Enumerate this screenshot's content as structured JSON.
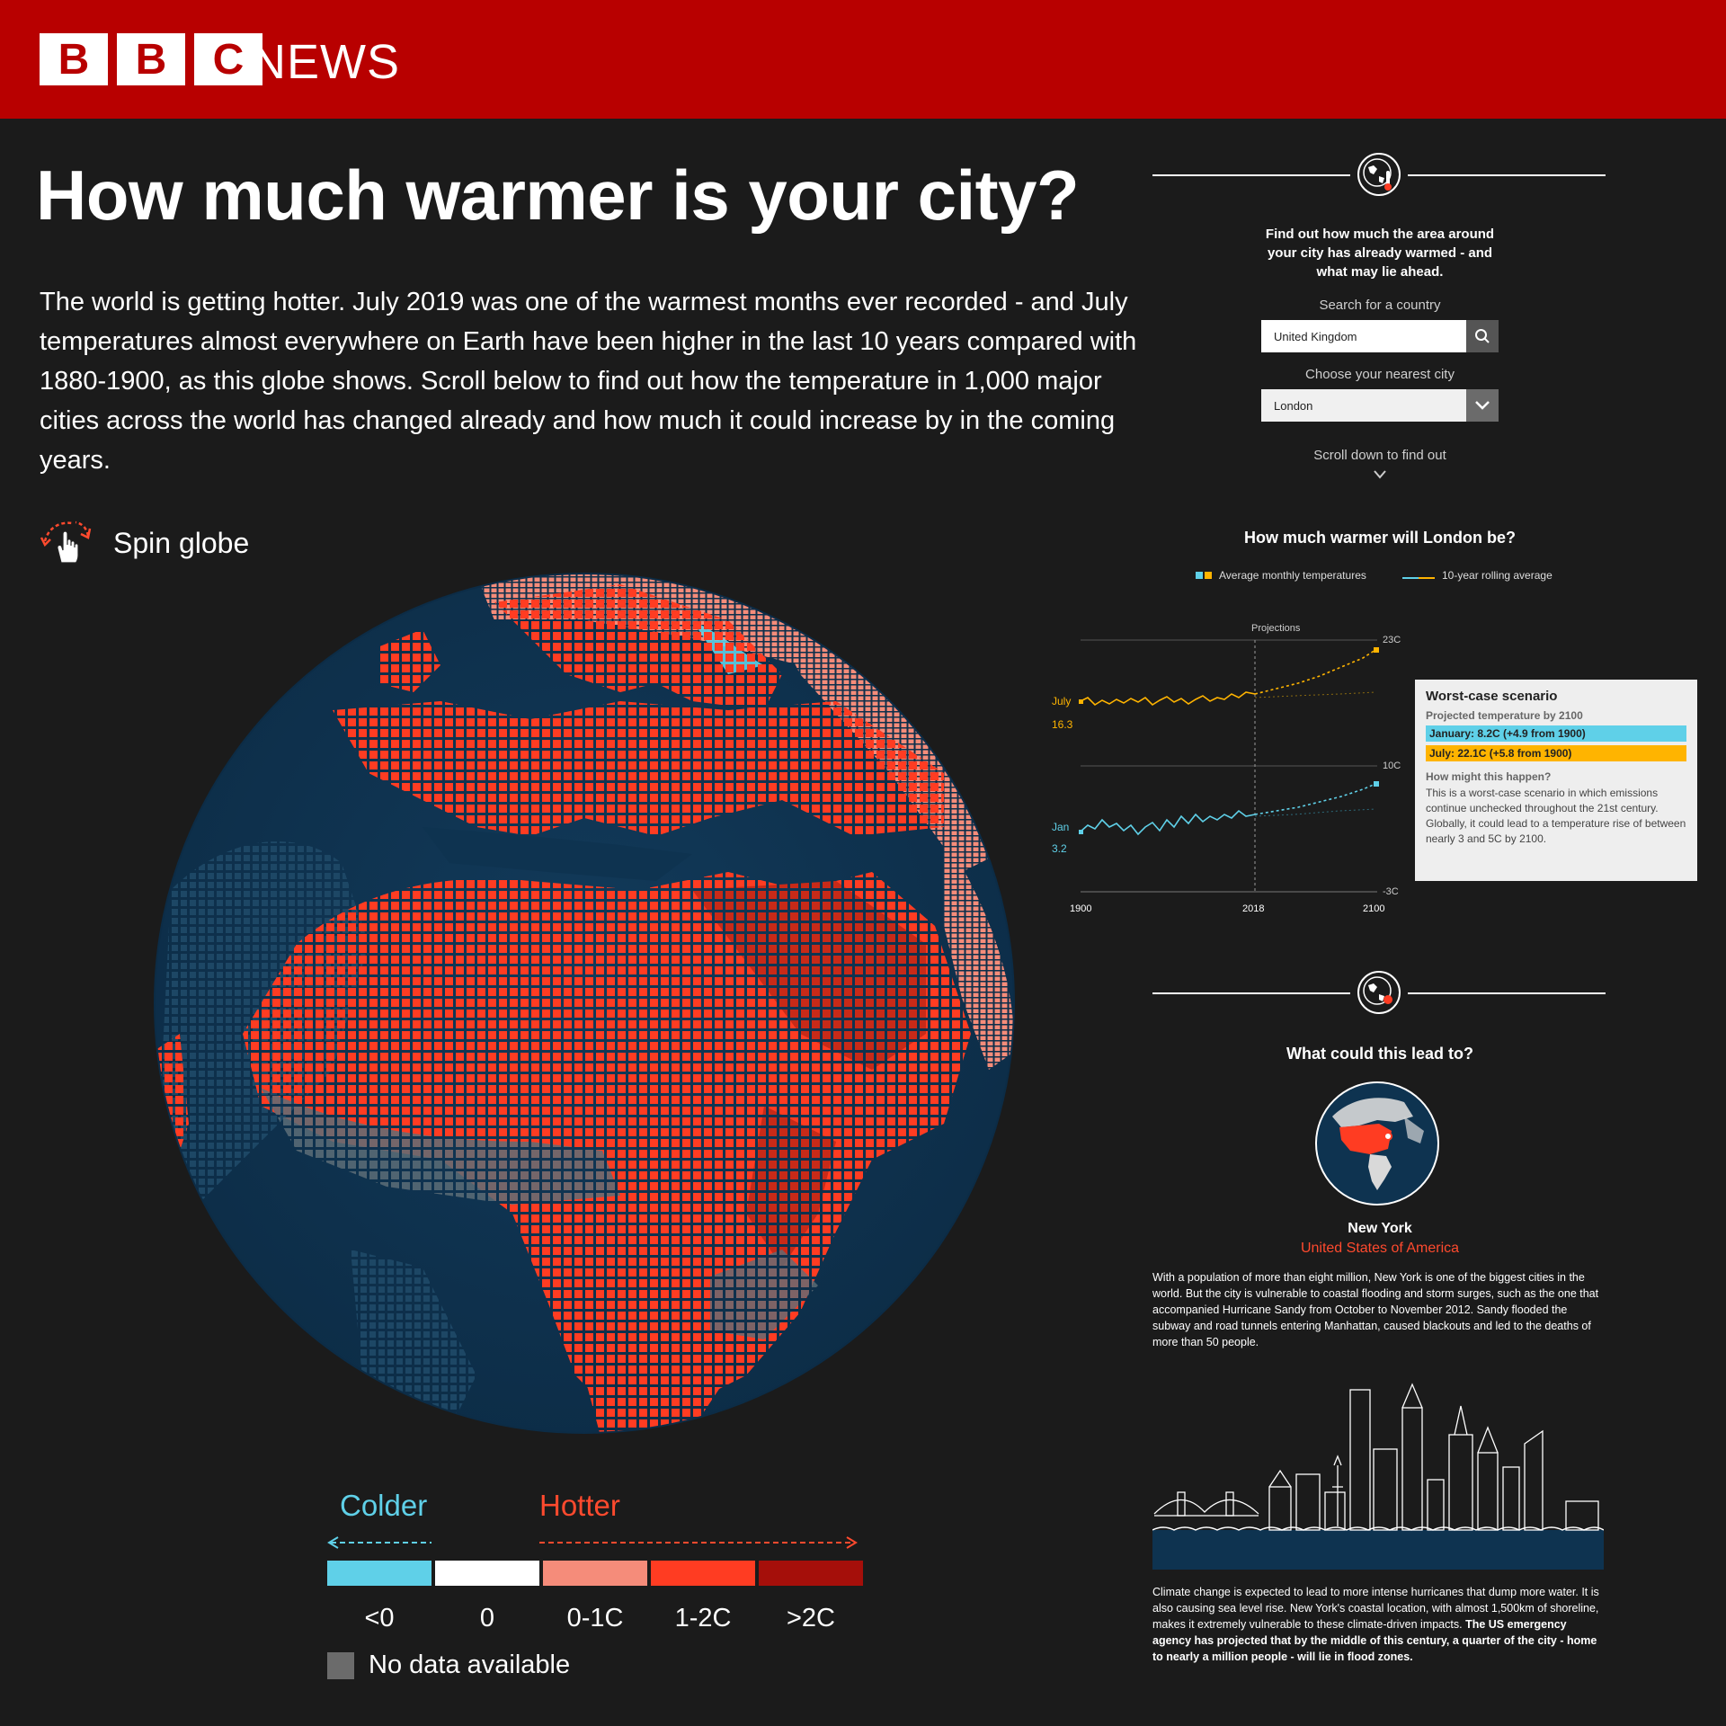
{
  "header": {
    "logo_letters": [
      "B",
      "B",
      "C"
    ],
    "news_label": "NEWS"
  },
  "headline": "How much warmer is your city?",
  "intro": "The world is getting hotter. July 2019 was one of the warmest months ever recorded - and July temperatures almost everywhere on Earth have been higher in the last 10 years compared with 1880-1900, as this globe shows. Scroll below to find out how the temperature in 1,000 major cities across the world has changed already and how much it could increase by in the coming years.",
  "spin": {
    "label": "Spin globe",
    "icon": "hand-drag-icon"
  },
  "legend": {
    "colder": "Colder",
    "hotter": "Hotter",
    "bins": [
      {
        "label": "<0",
        "color": "#5fd0e8"
      },
      {
        "label": "0",
        "color": "#ffffff"
      },
      {
        "label": "0-1C",
        "color": "#f58c7a"
      },
      {
        "label": "1-2C",
        "color": "#ff3c22"
      },
      {
        "label": ">2C",
        "color": "#a50f0a"
      }
    ],
    "no_data": "No data available",
    "no_data_color": "#6b6b6b"
  },
  "search": {
    "intro": "Find out how much the area around your city has already warmed - and what may lie ahead.",
    "country_label": "Search for a country",
    "country_value": "United Kingdom",
    "city_label": "Choose your nearest city",
    "city_value": "London",
    "scroll_hint": "Scroll down to find out"
  },
  "city_chart": {
    "title": "How much warmer will London be?",
    "legend_monthly": "Average monthly temperatures",
    "legend_rolling": "10-year rolling average",
    "projections_label": "Projections",
    "y_ticks": [
      "23C",
      "10C",
      "-3C"
    ],
    "x_ticks": [
      "1900",
      "2018",
      "2100"
    ],
    "july_label": "July",
    "july_value": "16.3",
    "jan_label": "Jan",
    "jan_value": "3.2"
  },
  "scenario": {
    "title": "Worst-case scenario",
    "subtitle": "Projected temperature by 2100",
    "january": "January: 8.2C (+4.9 from 1900)",
    "july": "July: 22.1C (+5.8 from 1900)",
    "question": "How might this happen?",
    "body": "This is a worst-case scenario in which emissions continue unchecked throughout the 21st century. Globally, it could lead to a temperature rise of between nearly 3 and 5C by 2100."
  },
  "lead": {
    "title": "What could this lead to?",
    "city": "New York",
    "country": "United States of America",
    "para1": "With a population of more than eight million, New York is one of the biggest cities in the world. But the city is vulnerable to coastal flooding and storm surges, such as the one that accompanied Hurricane Sandy from October to November 2012. Sandy flooded the subway and road tunnels entering Manhattan, caused blackouts and led to the deaths of more than 50 people.",
    "para2_plain": "Climate change is expected to lead to more intense hurricanes that dump more water. It is also causing sea level rise. New York's coastal location, with almost 1,500km of shoreline, makes it extremely vulnerable to these climate-driven impacts.",
    "para2_bold": "The US emergency agency has projected that by the middle of this century, a quarter of the city - home to nearly a million people - will lie in flood zones."
  },
  "colors": {
    "brand_red": "#b80000",
    "background": "#1b1b1b",
    "ocean": "#0e3350",
    "july_line": "#ffb400",
    "jan_line": "#5fd0e8"
  }
}
